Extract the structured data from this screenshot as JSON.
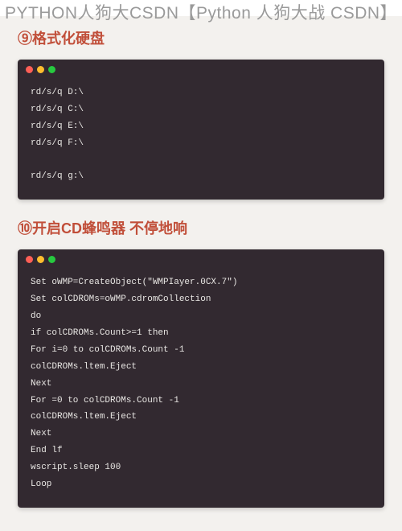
{
  "page_title": "PYTHON人狗大CSDN【Python 人狗大战 CSDN】",
  "section1": {
    "heading": "⑨格式化硬盘",
    "code_lines": [
      "rd/s/q D:\\",
      "rd/s/q C:\\",
      "rd/s/q E:\\",
      "rd/s/q F:\\",
      "",
      "rd/s/q g:\\"
    ]
  },
  "section2": {
    "heading": "⑩开启CD蜂鸣器 不停地响",
    "code_lines": [
      "Set oWMP=CreateObject(\"WMPIayer.0CX.7\")",
      "Set colCDROMs=oWMP.cdromCollection",
      "do",
      "if colCDROMs.Count>=1 then",
      "For i=0 to colCDROMs.Count -1",
      "colCDROMs.ltem.Eject",
      "Next",
      "For =0 to colCDROMs.Count -1",
      "colCDROMs.ltem.Eject",
      "Next",
      "End lf",
      "wscript.sleep 100",
      "Loop"
    ]
  }
}
